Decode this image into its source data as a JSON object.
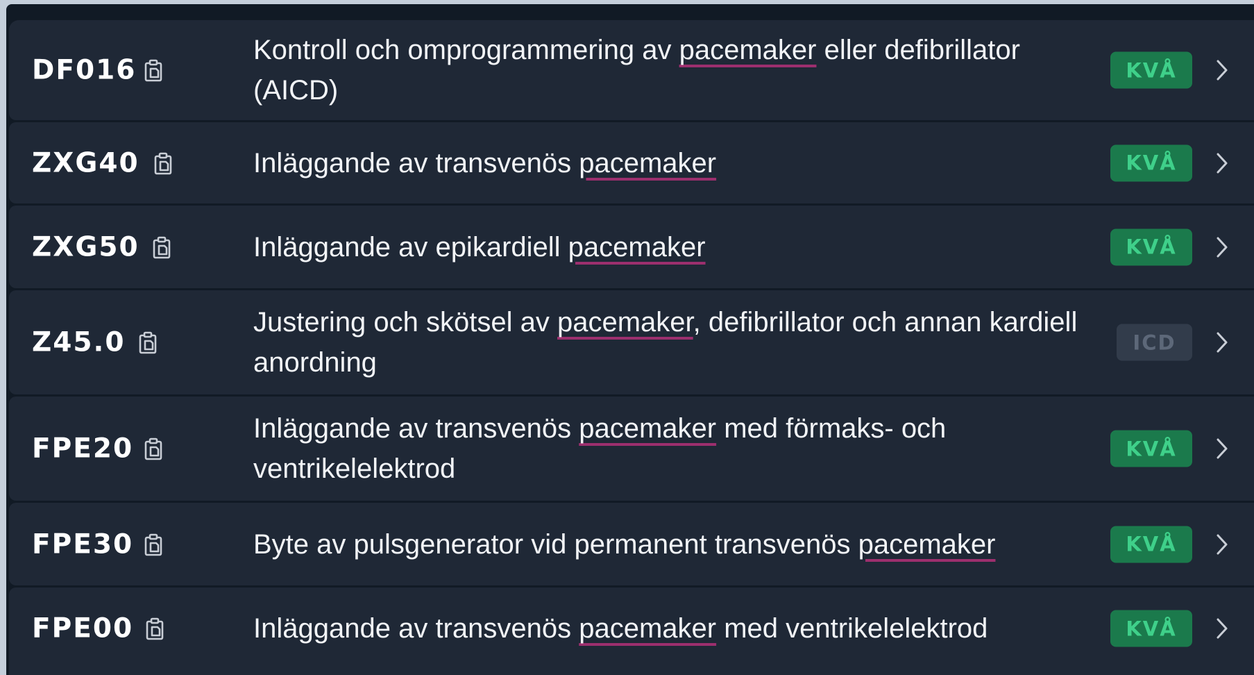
{
  "rows": [
    {
      "code": "DF016",
      "desc_before": "Kontroll och omprogrammering av ",
      "desc_highlight": "pacemaker",
      "desc_after": " eller defibrillator (AICD)",
      "badge": "KVÅ",
      "badge_type": "kva"
    },
    {
      "code": "ZXG40",
      "desc_before": "Inläggande av transvenös ",
      "desc_highlight": "pacemaker",
      "desc_after": "",
      "badge": "KVÅ",
      "badge_type": "kva"
    },
    {
      "code": "ZXG50",
      "desc_before": "Inläggande av epikardiell ",
      "desc_highlight": "pacemaker",
      "desc_after": "",
      "badge": "KVÅ",
      "badge_type": "kva"
    },
    {
      "code": "Z45.0",
      "desc_before": "Justering och skötsel av ",
      "desc_highlight": "pacemaker",
      "desc_after": ", defibrillator och annan kardiell anordning",
      "badge": "ICD",
      "badge_type": "icd"
    },
    {
      "code": "FPE20",
      "desc_before": "Inläggande av transvenös ",
      "desc_highlight": "pacemaker",
      "desc_after": " med förmaks- och ventrikelelektrod",
      "badge": "KVÅ",
      "badge_type": "kva"
    },
    {
      "code": "FPE30",
      "desc_before": "Byte av pulsgenerator vid permanent transvenös ",
      "desc_highlight": "pacemaker",
      "desc_after": "",
      "badge": "KVÅ",
      "badge_type": "kva"
    },
    {
      "code": "FPE00",
      "desc_before": "Inläggande av transvenös ",
      "desc_highlight": "pacemaker",
      "desc_after": " med ventrikelelektrod",
      "badge": "KVÅ",
      "badge_type": "kva"
    }
  ],
  "icons": {
    "copy": "clipboard-copy-icon",
    "chevron": "chevron-right-icon"
  },
  "colors": {
    "row_bg": "#1f2836",
    "separator": "#111a25",
    "highlight_underline": "#9c2f6e",
    "kva_badge_bg": "#1b7a4c",
    "kva_badge_text": "#3fd08a",
    "icd_badge_bg": "#323c4b",
    "icd_badge_text": "#5d6879"
  }
}
